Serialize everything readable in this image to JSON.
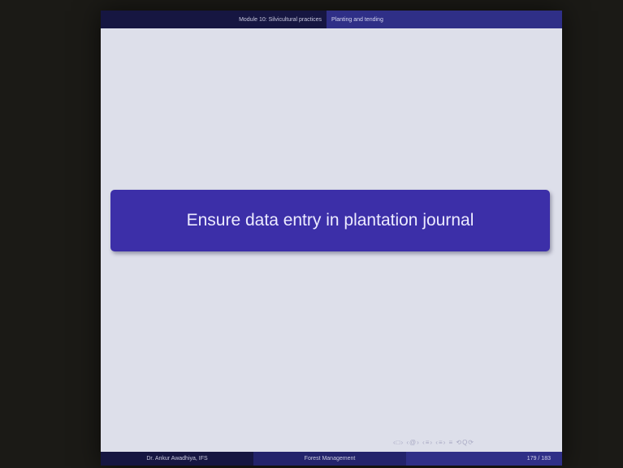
{
  "header": {
    "section": "Module 10: Silvicultural practices",
    "subsection": "Planting and tending"
  },
  "slide": {
    "title": "Ensure data entry in plantation journal"
  },
  "navigation": {
    "symbols": "‹□› ‹@› ‹≡› ‹≡›  ≡  ⟲Q⟳"
  },
  "footer": {
    "author": "Dr. Ankur Awadhiya, IFS",
    "course": "Forest Management",
    "page": "179 / 183"
  }
}
